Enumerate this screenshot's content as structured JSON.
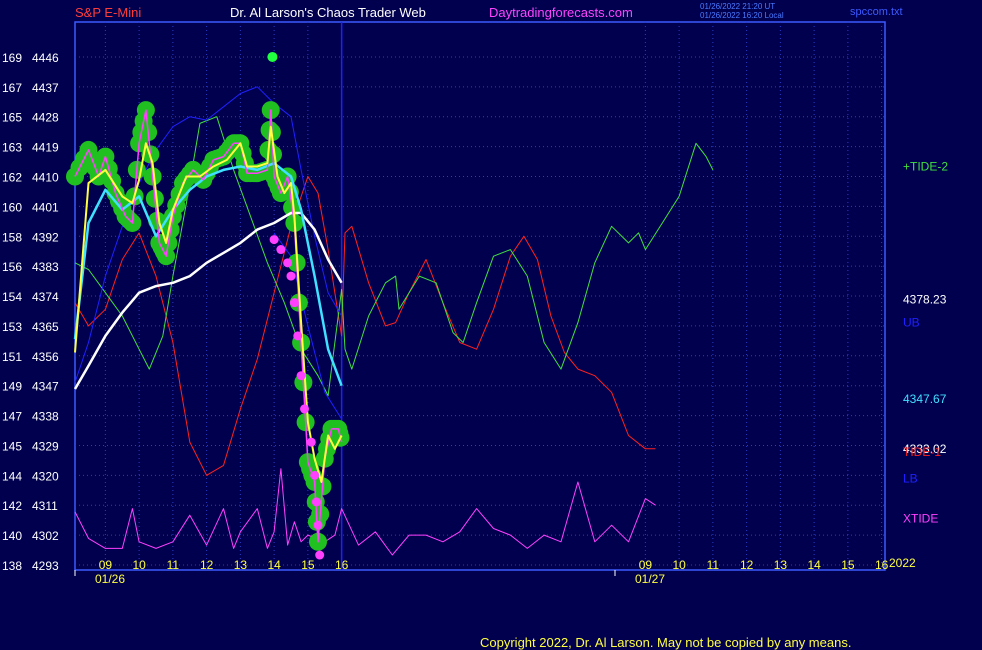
{
  "header": {
    "symbol": "S&P E-Mini",
    "title": "Dr. Al Larson's Chaos Trader Web",
    "site": "Daytradingforecasts.com",
    "stamp1": "01/26/2022 21:20 UT",
    "stamp2": "01/26/2022 16:20 Local",
    "filename": "spccom.txt"
  },
  "footer": {
    "copyright": "Copyright 2022, Dr. Al Larson. May not be copied by any means."
  },
  "colors": {
    "background": "#00004f",
    "grid": "#2c3cc8",
    "axis": "#3c5aff",
    "symbol": "#ff3c3c",
    "title": "#ffffff",
    "site": "#ff44ff",
    "tide_plus2": "#40e040",
    "tide_minus1": "#ff2020",
    "xtide": "#ff40ff",
    "ub_lb": "#2020ff",
    "cyan_band": "#40e0ff",
    "slow_avg": "#ffffff",
    "fast_avg": "#ffff40",
    "markers": "#20c020"
  },
  "chart_data": {
    "type": "line",
    "ylim": [
      4293,
      4449
    ],
    "y_ticks": [
      {
        "left": "169",
        "right": "4446"
      },
      {
        "left": "167",
        "right": "4437"
      },
      {
        "left": "165",
        "right": "4428"
      },
      {
        "left": "163",
        "right": "4419"
      },
      {
        "left": "162",
        "right": "4410"
      },
      {
        "left": "160",
        "right": "4401"
      },
      {
        "left": "158",
        "right": "4392"
      },
      {
        "left": "156",
        "right": "4383"
      },
      {
        "left": "154",
        "right": "4374"
      },
      {
        "left": "153",
        "right": "4365"
      },
      {
        "left": "151",
        "right": "4356"
      },
      {
        "left": "149",
        "right": "4347"
      },
      {
        "left": "147",
        "right": "4338"
      },
      {
        "left": "145",
        "right": "4329"
      },
      {
        "left": "144",
        "right": "4320"
      },
      {
        "left": "142",
        "right": "4311"
      },
      {
        "left": "140",
        "right": "4302"
      },
      {
        "left": "138",
        "right": "4293"
      }
    ],
    "x_hour_labels": [
      "09",
      "10",
      "11",
      "12",
      "13",
      "14",
      "15",
      "16",
      "09",
      "10",
      "11",
      "12",
      "13",
      "14",
      "15",
      "16"
    ],
    "x_hour_values": [
      9,
      10,
      11,
      12,
      13,
      14,
      15,
      16,
      25,
      26,
      27,
      28,
      29,
      30,
      31,
      32
    ],
    "x_range": [
      8.1,
      32.1
    ],
    "date_labels": [
      {
        "text": "01/26",
        "t": 8.5
      },
      {
        "text": "01/27",
        "t": 24.5
      }
    ],
    "year_label": "2022",
    "series": [
      {
        "name": "+TIDE-2",
        "label": "+TIDE-2",
        "points": [
          [
            8.1,
            4384
          ],
          [
            8.5,
            4382
          ],
          [
            9,
            4375
          ],
          [
            9.5,
            4368
          ],
          [
            10,
            4358
          ],
          [
            10.3,
            4352
          ],
          [
            10.7,
            4362
          ],
          [
            11,
            4380
          ],
          [
            11.4,
            4402
          ],
          [
            11.8,
            4426
          ],
          [
            12.3,
            4428
          ],
          [
            12.8,
            4412
          ],
          [
            13.3,
            4398
          ],
          [
            13.8,
            4384
          ],
          [
            14.3,
            4372
          ],
          [
            14.8,
            4358
          ],
          [
            15.3,
            4350
          ],
          [
            15.6,
            4344
          ],
          [
            16,
            4376
          ],
          [
            16.1,
            4358
          ],
          [
            16.3,
            4352
          ],
          [
            16.8,
            4368
          ],
          [
            17.3,
            4378
          ],
          [
            17.6,
            4380
          ],
          [
            17.7,
            4370
          ],
          [
            18.3,
            4380
          ],
          [
            18.8,
            4378
          ],
          [
            19.3,
            4363
          ],
          [
            19.6,
            4360
          ],
          [
            20,
            4372
          ],
          [
            20.5,
            4386
          ],
          [
            21,
            4388
          ],
          [
            21.5,
            4380
          ],
          [
            22,
            4360
          ],
          [
            22.5,
            4352
          ],
          [
            23,
            4366
          ],
          [
            23.5,
            4384
          ],
          [
            24,
            4395
          ],
          [
            24.5,
            4390
          ],
          [
            24.8,
            4393
          ],
          [
            25,
            4388
          ],
          [
            25.5,
            4396
          ],
          [
            26,
            4404
          ],
          [
            26.5,
            4420
          ],
          [
            26.8,
            4416
          ],
          [
            27,
            4412
          ]
        ]
      },
      {
        "name": "TIDE-1",
        "label": "TIDE-1",
        "points": [
          [
            8.1,
            4372
          ],
          [
            8.5,
            4365
          ],
          [
            9,
            4370
          ],
          [
            9.5,
            4385
          ],
          [
            10,
            4393
          ],
          [
            10.5,
            4380
          ],
          [
            11,
            4360
          ],
          [
            11.5,
            4330
          ],
          [
            12,
            4320
          ],
          [
            12.5,
            4323
          ],
          [
            13,
            4340
          ],
          [
            13.5,
            4355
          ],
          [
            14,
            4375
          ],
          [
            14.5,
            4395
          ],
          [
            15,
            4410
          ],
          [
            15.3,
            4405
          ],
          [
            15.6,
            4388
          ],
          [
            16,
            4362
          ],
          [
            16.1,
            4393
          ],
          [
            16.3,
            4395
          ],
          [
            16.8,
            4378
          ],
          [
            17.3,
            4365
          ],
          [
            17.6,
            4366
          ],
          [
            18,
            4375
          ],
          [
            18.5,
            4385
          ],
          [
            19,
            4372
          ],
          [
            19.5,
            4360
          ],
          [
            20,
            4358
          ],
          [
            20.5,
            4370
          ],
          [
            21,
            4386
          ],
          [
            21.4,
            4392
          ],
          [
            21.8,
            4385
          ],
          [
            22.2,
            4368
          ],
          [
            22.6,
            4357
          ],
          [
            23,
            4352
          ],
          [
            23.5,
            4350
          ],
          [
            24,
            4345
          ],
          [
            24.5,
            4332
          ],
          [
            25,
            4328
          ],
          [
            25.3,
            4328
          ]
        ]
      },
      {
        "name": "XTIDE",
        "label": "XTIDE",
        "points": [
          [
            8.1,
            4309
          ],
          [
            8.5,
            4301
          ],
          [
            9,
            4298
          ],
          [
            9.5,
            4298
          ],
          [
            9.8,
            4310
          ],
          [
            10,
            4300
          ],
          [
            10.5,
            4298
          ],
          [
            11,
            4300
          ],
          [
            11.5,
            4308
          ],
          [
            12,
            4299
          ],
          [
            12.5,
            4310
          ],
          [
            12.8,
            4298
          ],
          [
            13,
            4303
          ],
          [
            13.5,
            4310
          ],
          [
            13.8,
            4298
          ],
          [
            14,
            4303
          ],
          [
            14.2,
            4322
          ],
          [
            14.4,
            4299
          ],
          [
            14.6,
            4306
          ],
          [
            14.8,
            4300
          ],
          [
            15,
            4302
          ],
          [
            15.5,
            4300
          ],
          [
            15.8,
            4302
          ],
          [
            16,
            4310
          ],
          [
            16.5,
            4299
          ],
          [
            17,
            4303
          ],
          [
            17.5,
            4296
          ],
          [
            18,
            4302
          ],
          [
            18.5,
            4302
          ],
          [
            19,
            4300
          ],
          [
            19.5,
            4303
          ],
          [
            20,
            4310
          ],
          [
            20.5,
            4304
          ],
          [
            21,
            4302
          ],
          [
            21.5,
            4298
          ],
          [
            22,
            4302
          ],
          [
            22.5,
            4300
          ],
          [
            23,
            4318
          ],
          [
            23.5,
            4300
          ],
          [
            24,
            4305
          ],
          [
            24.5,
            4300
          ],
          [
            25,
            4313
          ],
          [
            25.3,
            4311
          ]
        ]
      },
      {
        "name": "UB",
        "label": "UB",
        "points": [
          [
            8.1,
            4348
          ],
          [
            8.5,
            4360
          ],
          [
            9,
            4380
          ],
          [
            9.5,
            4395
          ],
          [
            10,
            4408
          ],
          [
            10.5,
            4418
          ],
          [
            11,
            4425
          ],
          [
            11.5,
            4428
          ],
          [
            12,
            4427
          ],
          [
            12.5,
            4431
          ],
          [
            13,
            4435
          ],
          [
            13.5,
            4437
          ],
          [
            14,
            4432
          ],
          [
            14.5,
            4428
          ],
          [
            14.8,
            4412
          ],
          [
            15.2,
            4392
          ],
          [
            15.6,
            4375
          ],
          [
            16,
            4368
          ]
        ]
      },
      {
        "name": "LB",
        "label": "LB",
        "points": [
          [
            14,
            4393
          ],
          [
            14.5,
            4386
          ],
          [
            15,
            4365
          ],
          [
            15.5,
            4345
          ],
          [
            16,
            4337
          ]
        ]
      },
      {
        "name": "cyan",
        "label": "",
        "points": [
          [
            8.1,
            4361
          ],
          [
            8.5,
            4396
          ],
          [
            9,
            4406
          ],
          [
            9.5,
            4400
          ],
          [
            10,
            4404
          ],
          [
            10.5,
            4392
          ],
          [
            11,
            4400
          ],
          [
            11.5,
            4406
          ],
          [
            12,
            4410
          ],
          [
            12.5,
            4412
          ],
          [
            13,
            4413
          ],
          [
            13.5,
            4412
          ],
          [
            14,
            4414
          ],
          [
            14.5,
            4410
          ],
          [
            14.8,
            4400
          ],
          [
            15.2,
            4380
          ],
          [
            15.6,
            4358
          ],
          [
            16,
            4347
          ]
        ]
      },
      {
        "name": "white",
        "label": "",
        "points": [
          [
            8.1,
            4346
          ],
          [
            8.5,
            4353
          ],
          [
            9,
            4362
          ],
          [
            9.5,
            4369
          ],
          [
            10,
            4375
          ],
          [
            10.5,
            4377
          ],
          [
            11,
            4378
          ],
          [
            11.5,
            4380
          ],
          [
            12,
            4384
          ],
          [
            12.5,
            4387
          ],
          [
            13,
            4390
          ],
          [
            13.5,
            4394
          ],
          [
            14,
            4396
          ],
          [
            14.5,
            4399
          ],
          [
            14.8,
            4399
          ],
          [
            15.2,
            4394
          ],
          [
            15.6,
            4385
          ],
          [
            16,
            4378
          ]
        ]
      },
      {
        "name": "yellow",
        "label": "",
        "points": [
          [
            8.1,
            4357
          ],
          [
            8.5,
            4408
          ],
          [
            9,
            4412
          ],
          [
            9.5,
            4404
          ],
          [
            9.8,
            4402
          ],
          [
            10,
            4409
          ],
          [
            10.2,
            4420
          ],
          [
            10.4,
            4414
          ],
          [
            10.6,
            4396
          ],
          [
            10.8,
            4390
          ],
          [
            11,
            4400
          ],
          [
            11.4,
            4410
          ],
          [
            11.8,
            4410
          ],
          [
            12.2,
            4413
          ],
          [
            12.6,
            4415
          ],
          [
            13,
            4420
          ],
          [
            13.2,
            4413
          ],
          [
            13.5,
            4413
          ],
          [
            13.8,
            4414
          ],
          [
            13.9,
            4425
          ],
          [
            14.1,
            4410
          ],
          [
            14.3,
            4405
          ],
          [
            14.5,
            4408
          ],
          [
            14.6,
            4398
          ],
          [
            14.8,
            4366
          ],
          [
            15,
            4336
          ],
          [
            15.2,
            4325
          ],
          [
            15.4,
            4318
          ],
          [
            15.6,
            4332
          ],
          [
            15.8,
            4328
          ],
          [
            16,
            4332
          ]
        ]
      },
      {
        "name": "price",
        "label": "",
        "points": [
          [
            8.1,
            4410
          ],
          [
            8.5,
            4418
          ],
          [
            8.8,
            4410
          ],
          [
            9,
            4416
          ],
          [
            9.3,
            4405
          ],
          [
            9.6,
            4398
          ],
          [
            9.8,
            4396
          ],
          [
            10,
            4420
          ],
          [
            10.2,
            4430
          ],
          [
            10.4,
            4410
          ],
          [
            10.6,
            4390
          ],
          [
            10.8,
            4386
          ],
          [
            11,
            4398
          ],
          [
            11.3,
            4408
          ],
          [
            11.6,
            4412
          ],
          [
            11.9,
            4409
          ],
          [
            12.2,
            4415
          ],
          [
            12.5,
            4416
          ],
          [
            12.8,
            4420
          ],
          [
            13,
            4420
          ],
          [
            13.2,
            4411
          ],
          [
            13.5,
            4411
          ],
          [
            13.8,
            4412
          ],
          [
            13.9,
            4430
          ],
          [
            14,
            4410
          ],
          [
            14.2,
            4405
          ],
          [
            14.4,
            4410
          ],
          [
            14.6,
            4396
          ],
          [
            14.8,
            4360
          ],
          [
            15,
            4324
          ],
          [
            15.2,
            4318
          ],
          [
            15.3,
            4300
          ],
          [
            15.5,
            4325
          ],
          [
            15.7,
            4334
          ],
          [
            15.9,
            4334
          ],
          [
            16,
            4330
          ]
        ]
      }
    ],
    "right_labels": [
      {
        "text": "+TIDE-2",
        "value": 4413,
        "color": "#40e040"
      },
      {
        "text": "4378.23",
        "value": 4373,
        "color": "#ffffff"
      },
      {
        "text": "UB",
        "value": 4366,
        "color": "#2020ff"
      },
      {
        "text": "4347.67",
        "value": 4343,
        "color": "#40e0ff"
      },
      {
        "text": "4333.02",
        "value": 4328,
        "color": "#ffffff"
      },
      {
        "text": "TIDE-1",
        "value": 4327,
        "color": "#ff2020"
      },
      {
        "text": "LB",
        "value": 4319,
        "color": "#2020ff"
      },
      {
        "text": "XTIDE",
        "value": 4307,
        "color": "#ff40ff"
      }
    ],
    "grid": true
  }
}
